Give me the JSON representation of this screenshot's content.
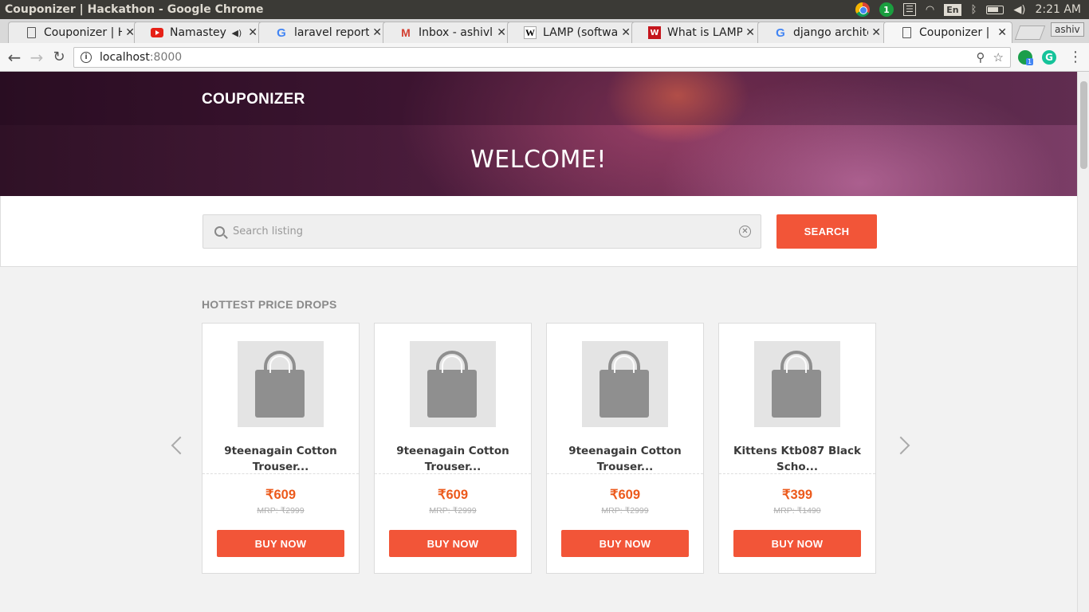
{
  "window": {
    "title": "Couponizer | Hackathon - Google Chrome",
    "tray": {
      "notification_count": "1",
      "language": "En",
      "time": "2:21 AM"
    }
  },
  "browser": {
    "tabs": [
      {
        "title": "Couponizer | H",
        "favicon": "document-icon"
      },
      {
        "title": "Namastey L",
        "favicon": "youtube-icon",
        "audio": "speaker-icon"
      },
      {
        "title": "laravel report",
        "favicon": "google-icon"
      },
      {
        "title": "Inbox - ashivli",
        "favicon": "gmail-icon"
      },
      {
        "title": "LAMP (softwa",
        "favicon": "wikipedia-icon"
      },
      {
        "title": "What is LAMP",
        "favicon": "whatis-icon"
      },
      {
        "title": "django archite",
        "favicon": "google-icon"
      },
      {
        "title": "Couponizer | H",
        "favicon": "document-icon",
        "active": true
      }
    ],
    "profile_name": "ashiv",
    "url_host": "localhost",
    "url_port": ":8000",
    "extension_badge": "1"
  },
  "page": {
    "brand": "COUPONIZER",
    "welcome": "WELCOME!",
    "search": {
      "placeholder": "Search listing",
      "value": "",
      "button_label": "SEARCH"
    },
    "section_title": "HOTTEST PRICE DROPS",
    "products": [
      {
        "name_line1": "9teenagain Cotton",
        "name_line2": "Trouser...",
        "price": "₹609",
        "mrp": "MRP: ₹2999",
        "button_label": "BUY NOW"
      },
      {
        "name_line1": "9teenagain Cotton",
        "name_line2": "Trouser...",
        "price": "₹609",
        "mrp": "MRP: ₹2999",
        "button_label": "BUY NOW"
      },
      {
        "name_line1": "9teenagain Cotton",
        "name_line2": "Trouser...",
        "price": "₹609",
        "mrp": "MRP: ₹2999",
        "button_label": "BUY NOW"
      },
      {
        "name_line1": "Kittens Ktb087 Black",
        "name_line2": "Scho...",
        "price": "₹399",
        "mrp": "MRP: ₹1490",
        "button_label": "BUY NOW"
      }
    ]
  },
  "colors": {
    "accent": "#f25538",
    "price": "#ec5a1c",
    "hero_dark": "#2f1126",
    "hero_light": "#7a3d66"
  }
}
